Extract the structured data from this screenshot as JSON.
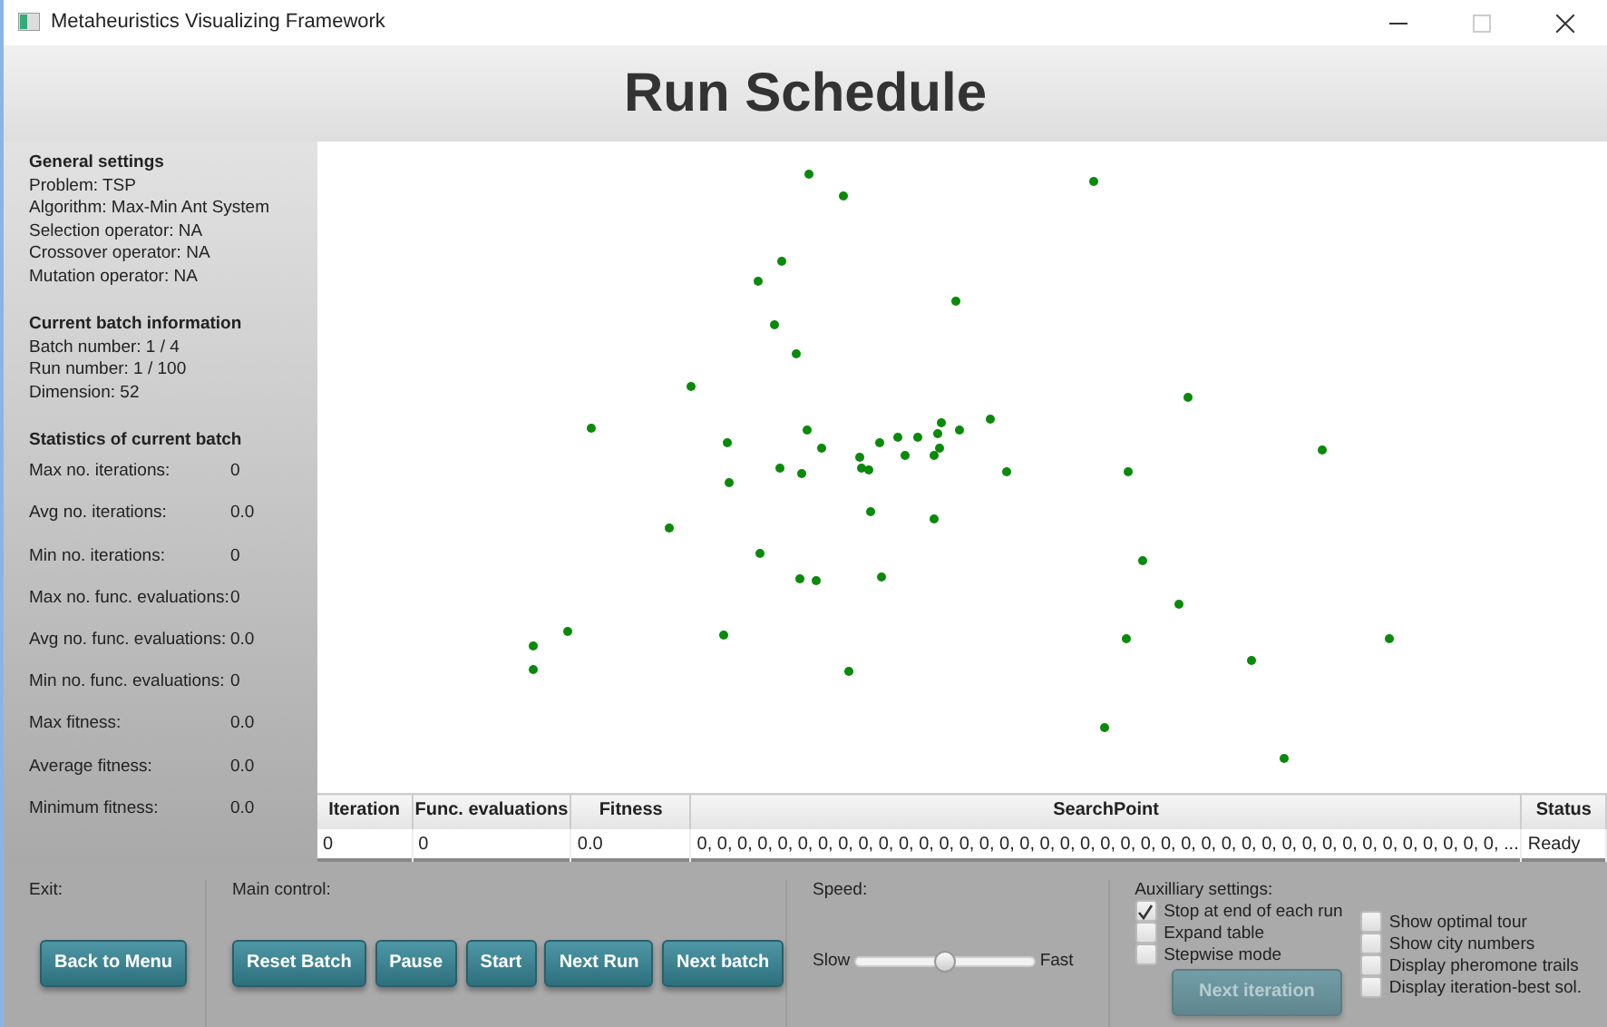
{
  "window": {
    "title": "Metaheuristics Visualizing Framework"
  },
  "heading": "Run Schedule",
  "sidebar": {
    "sections": [
      {
        "title": "General settings",
        "lines": [
          "Problem: TSP",
          "Algorithm: Max-Min Ant System",
          "Selection operator: NA",
          "Crossover operator: NA",
          "Mutation operator: NA"
        ]
      },
      {
        "title": "Current batch information",
        "lines": [
          "Batch number: 1 / 4",
          "Run number: 1 / 100",
          "Dimension: 52"
        ]
      }
    ],
    "stats_title": "Statistics of current batch",
    "stats": [
      {
        "label": "Max no. iterations:",
        "value": "0"
      },
      {
        "label": "Avg no. iterations:",
        "value": "0.0"
      },
      {
        "label": "Min no. iterations:",
        "value": "0"
      },
      {
        "label": "Max no. func. evaluations:",
        "value": "0"
      },
      {
        "label": "Avg no. func. evaluations:",
        "value": "0.0"
      },
      {
        "label": "Min no. func. evaluations:",
        "value": "0"
      },
      {
        "label": "Max fitness:",
        "value": "0.0"
      },
      {
        "label": "Average fitness:",
        "value": "0.0"
      },
      {
        "label": "Minimum fitness:",
        "value": "0.0"
      }
    ]
  },
  "table": {
    "columns": [
      "Iteration",
      "Func. evaluations",
      "Fitness",
      "SearchPoint",
      "Status"
    ],
    "rows": [
      [
        "0",
        "0",
        "0.0",
        "0, 0, 0, 0, 0, 0, 0, 0, 0, 0, 0, 0, 0, 0, 0, 0, 0, 0, 0, 0, 0, 0, 0, 0, 0, 0, 0, 0, 0, 0, 0, 0, 0, 0, 0, 0, 0, 0, 0, 0, ...",
        "Ready"
      ]
    ]
  },
  "controls": {
    "exit_label": "Exit:",
    "exit_button": "Back to Menu",
    "main_label": "Main control:",
    "main_buttons": [
      "Reset Batch",
      "Pause",
      "Start",
      "Next Run",
      "Next batch"
    ],
    "speed_label": "Speed:",
    "speed": {
      "min_label": "Slow",
      "max_label": "Fast",
      "level": 0.5
    },
    "aux_label": "Auxilliary settings:",
    "aux_left": [
      {
        "label": "Stop at end of each run",
        "checked": true
      },
      {
        "label": "Expand table",
        "checked": false
      },
      {
        "label": "Stepwise mode",
        "checked": false
      }
    ],
    "next_iteration": {
      "label": "Next iteration",
      "disabled": true
    },
    "aux_right": [
      {
        "label": "Show optimal tour",
        "checked": false
      },
      {
        "label": "Show city numbers",
        "checked": false
      },
      {
        "label": "Display pheromone trails",
        "checked": false
      },
      {
        "label": "Display iteration-best sol.",
        "checked": false
      }
    ]
  }
}
